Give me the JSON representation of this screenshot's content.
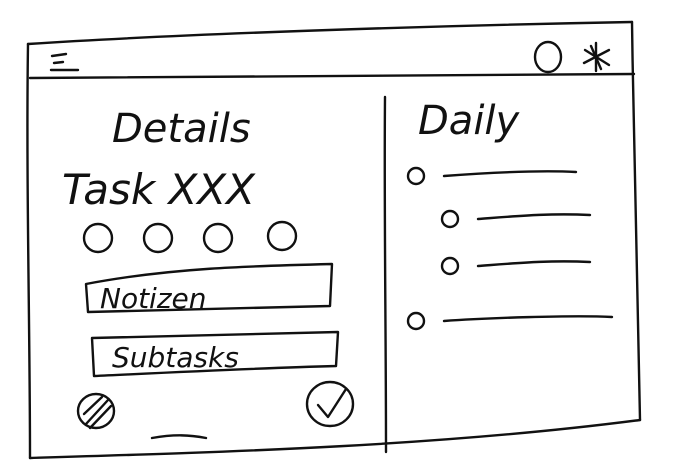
{
  "details_panel": {
    "title": "Details",
    "task_title": "Task XXX",
    "rating_count": 4,
    "notes_label": "Notizen",
    "subtasks_label": "Subtasks"
  },
  "daily_panel": {
    "title": "Daily",
    "items": [
      {
        "indent": 0
      },
      {
        "indent": 1
      },
      {
        "indent": 1
      },
      {
        "indent": 0
      }
    ]
  },
  "icons": {
    "menu": "hamburger-menu-icon",
    "search": "circle-icon",
    "settings": "asterisk-icon",
    "edit": "pencil-icon",
    "confirm": "checkmark-icon"
  }
}
